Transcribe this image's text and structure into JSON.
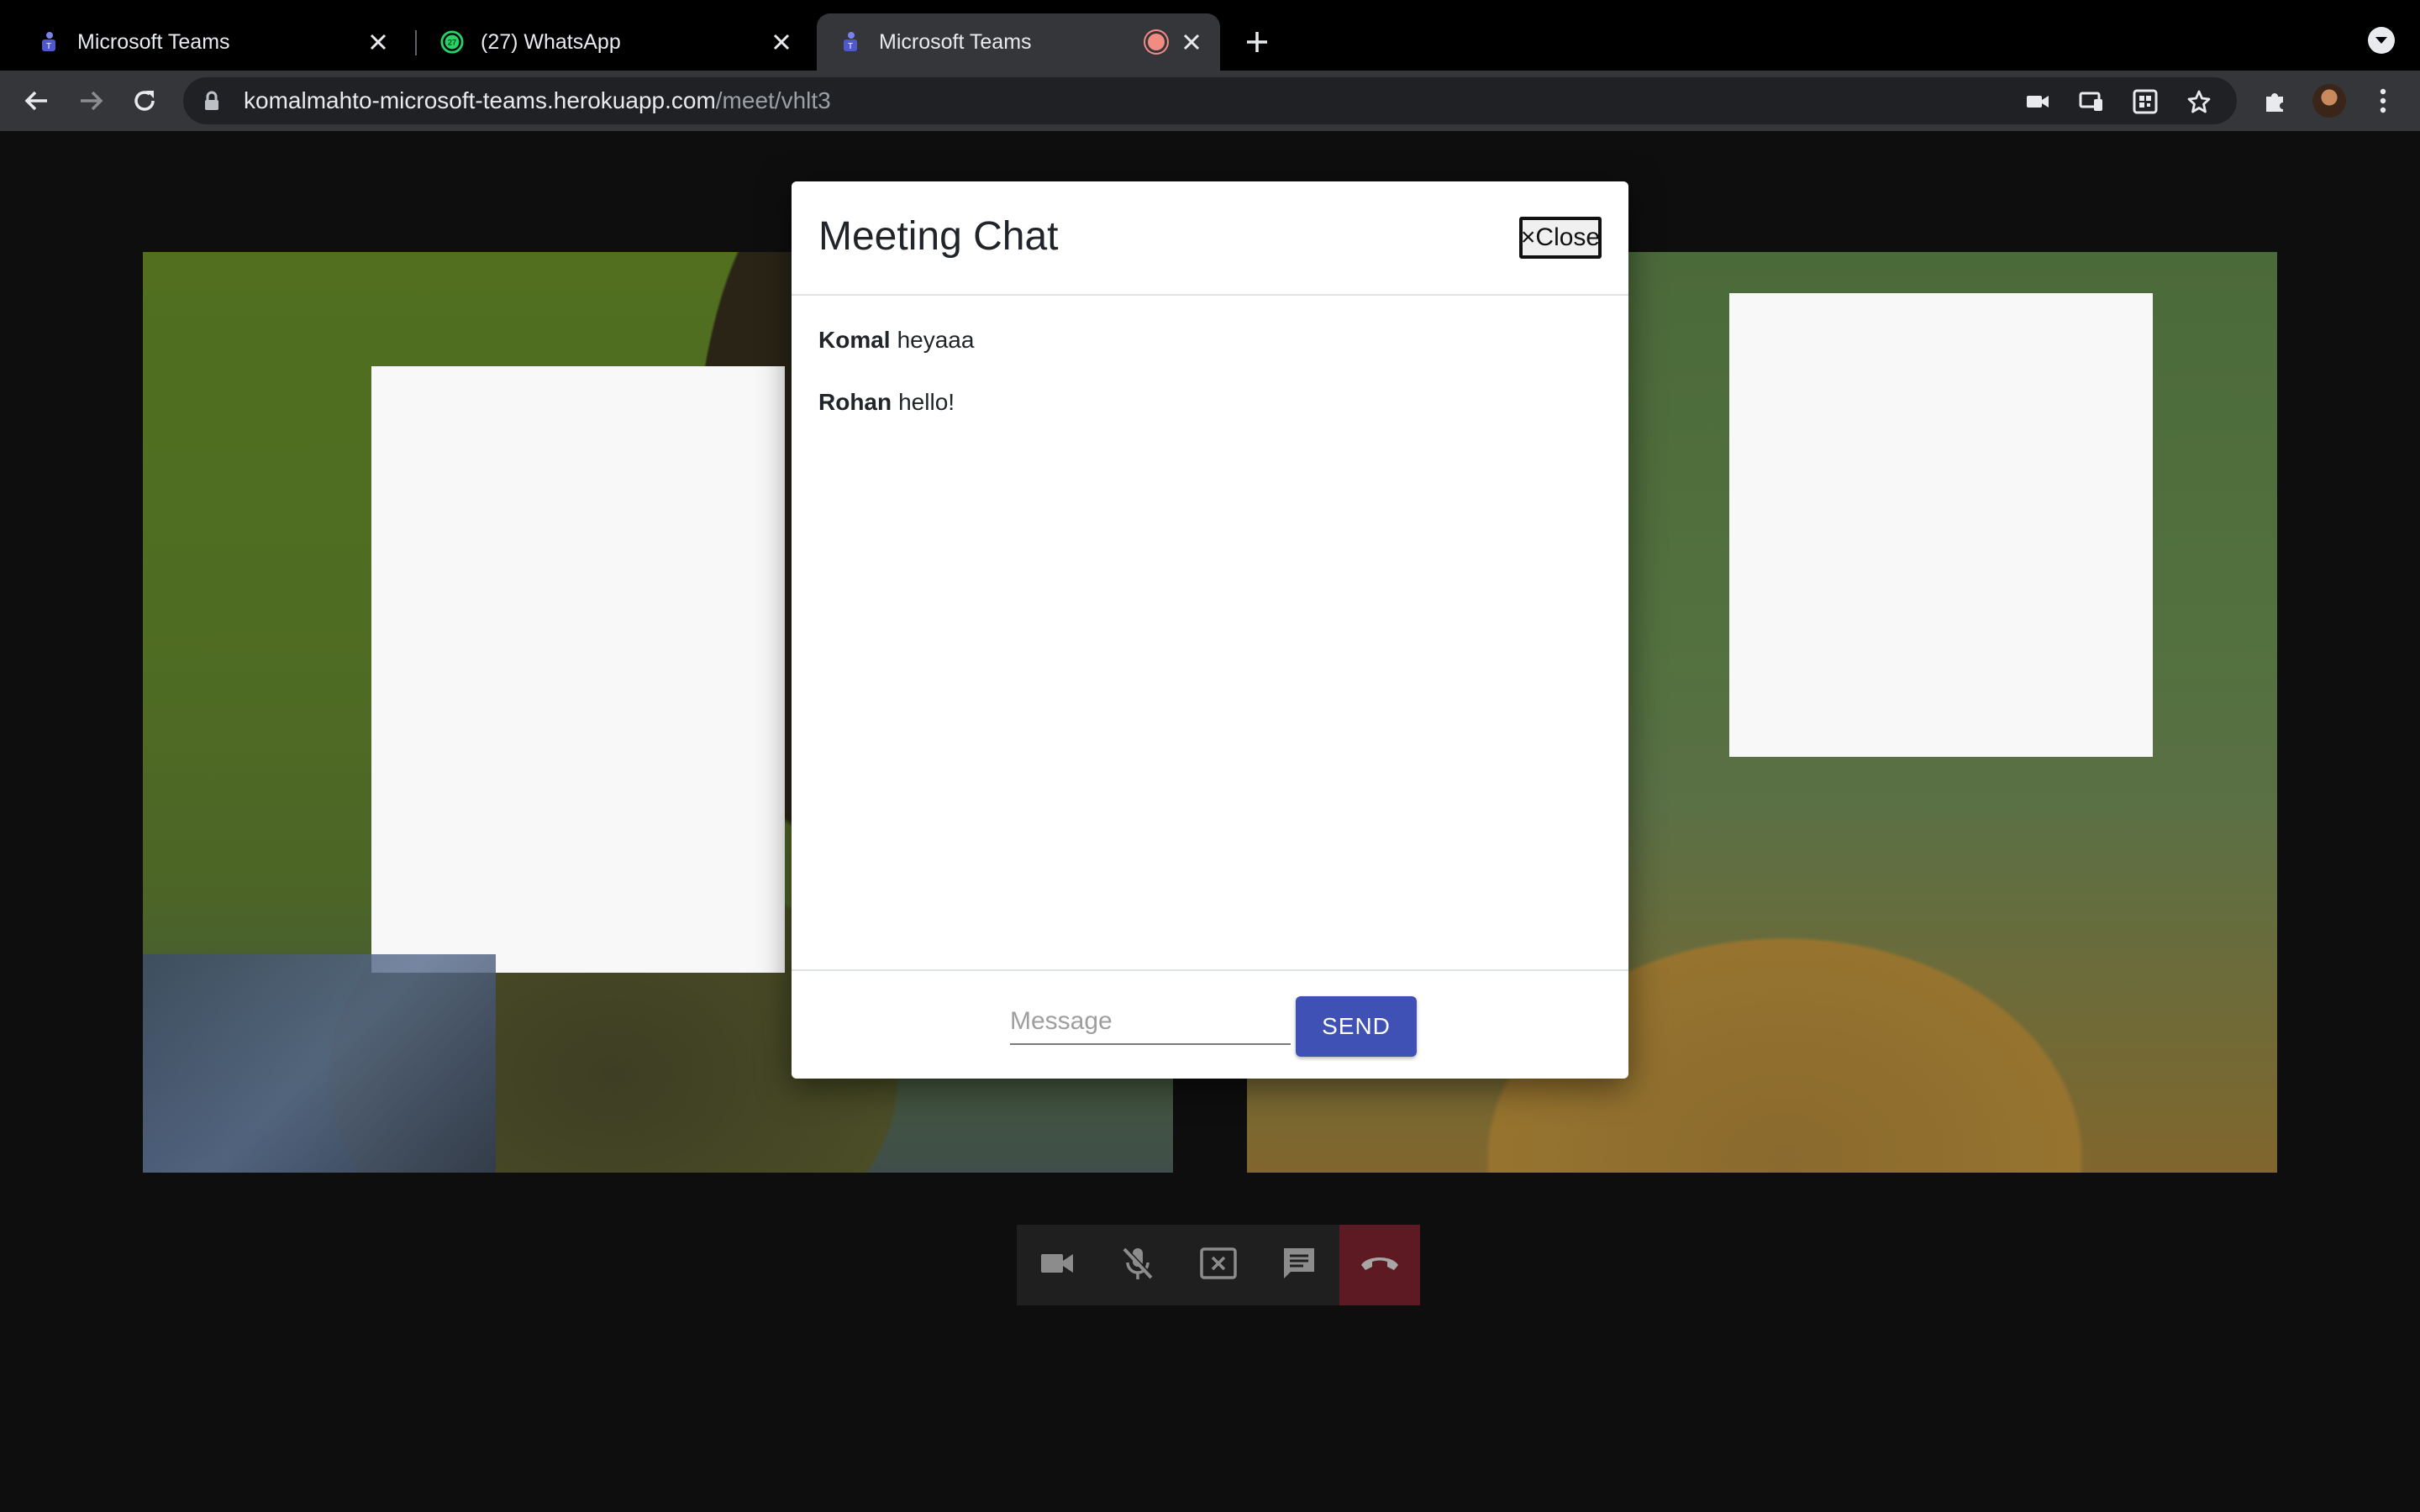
{
  "browser": {
    "tabs": [
      {
        "title": "Microsoft Teams",
        "icon": "teams-icon"
      },
      {
        "title": "(27) WhatsApp",
        "icon": "whatsapp-icon",
        "badge": "27"
      },
      {
        "title": "Microsoft Teams",
        "icon": "teams-icon",
        "active": true,
        "recording": true
      }
    ],
    "url_host": "komalmahto-microsoft-teams.herokuapp.com",
    "url_path": "/meet/vhlt3"
  },
  "dialog": {
    "title": "Meeting Chat",
    "close_label": "×Close",
    "messages": [
      {
        "sender": "Komal",
        "text": "heyaaa"
      },
      {
        "sender": "Rohan",
        "text": "hello!"
      }
    ],
    "input_placeholder": "Message",
    "input_value": "",
    "send_label": "SEND"
  },
  "controls": [
    {
      "name": "camera",
      "icon": "video-camera-icon"
    },
    {
      "name": "microphone",
      "icon": "mic-off-icon"
    },
    {
      "name": "screen-share",
      "icon": "stop-screen-share-icon"
    },
    {
      "name": "chat",
      "icon": "chat-icon"
    },
    {
      "name": "hang-up",
      "icon": "hang-up-icon"
    }
  ],
  "colors": {
    "send_button": "#3f51b5",
    "hang_up": "#5e1a22",
    "page_background": "#0e0e0e"
  }
}
